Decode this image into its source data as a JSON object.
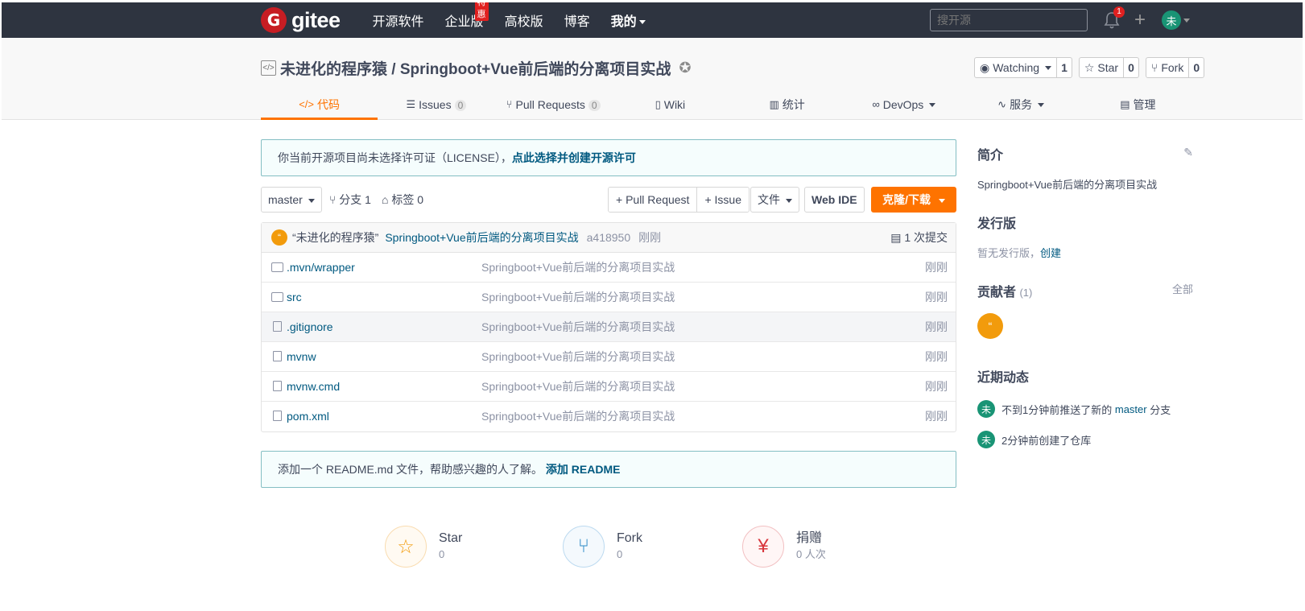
{
  "navbar": {
    "logo_mark": "G",
    "logo_text": "gitee",
    "items": [
      "开源软件",
      "企业版",
      "高校版",
      "博客",
      "我的"
    ],
    "hot_badge": "特惠",
    "search_placeholder": "搜开源",
    "notification_count": "1",
    "plus": "+",
    "user_initial": "未"
  },
  "project": {
    "title": "未进化的程序猿 / Springboot+Vue前后端的分离项目实战",
    "watching_label": "Watching",
    "watching_count": "1",
    "star_label": "Star",
    "star_count": "0",
    "fork_label": "Fork",
    "fork_count": "0"
  },
  "tabs": [
    {
      "label": "代码",
      "icon": "</>"
    },
    {
      "label": "Issues",
      "count": "0",
      "icon": "☰"
    },
    {
      "label": "Pull Requests",
      "count": "0",
      "icon": "⑂"
    },
    {
      "label": "Wiki",
      "icon": "▯"
    },
    {
      "label": "统计",
      "icon": "▥"
    },
    {
      "label": "DevOps",
      "icon": "∞"
    },
    {
      "label": "服务",
      "icon": "∿"
    },
    {
      "label": "管理",
      "icon": "▤"
    }
  ],
  "license_notice": {
    "text": "你当前开源项目尚未选择许可证（LICENSE），",
    "link": "点此选择并创建开源许可"
  },
  "toolbar": {
    "branch": "master",
    "branch_count_label": "分支 1",
    "tag_count_label": "标签 0",
    "pull_request": "+ Pull Request",
    "issue": "+ Issue",
    "file": "文件",
    "web_ide": "Web IDE",
    "clone": "克隆/下载"
  },
  "last_commit": {
    "avatar": "“",
    "author": "“未进化的程序猿”",
    "message": "Springboot+Vue前后端的分离项目实战",
    "sha": "a418950",
    "time": "刚刚",
    "count_label": "1 次提交"
  },
  "files": [
    {
      "name": ".mvn/wrapper",
      "type": "folder",
      "message": "Springboot+Vue前后端的分离项目实战",
      "time": "刚刚"
    },
    {
      "name": "src",
      "type": "folder",
      "message": "Springboot+Vue前后端的分离项目实战",
      "time": "刚刚"
    },
    {
      "name": ".gitignore",
      "type": "file",
      "message": "Springboot+Vue前后端的分离项目实战",
      "time": "刚刚"
    },
    {
      "name": "mvnw",
      "type": "file",
      "message": "Springboot+Vue前后端的分离项目实战",
      "time": "刚刚"
    },
    {
      "name": "mvnw.cmd",
      "type": "file",
      "message": "Springboot+Vue前后端的分离项目实战",
      "time": "刚刚"
    },
    {
      "name": "pom.xml",
      "type": "file",
      "message": "Springboot+Vue前后端的分离项目实战",
      "time": "刚刚"
    }
  ],
  "readme_notice": {
    "text": "添加一个 README.md 文件，帮助感兴趣的人了解。",
    "link": "添加 README"
  },
  "stats": [
    {
      "title": "Star",
      "value": "0",
      "icon": "☆",
      "color": "#f29b0c"
    },
    {
      "title": "Fork",
      "value": "0",
      "icon": "⑂",
      "color": "#2d8ac7"
    },
    {
      "title": "捐赠",
      "value": "0 人次",
      "icon": "¥",
      "color": "#d8363d"
    }
  ],
  "sidebar": {
    "intro_title": "简介",
    "intro_text": "Springboot+Vue前后端的分离项目实战",
    "release_title": "发行版",
    "release_text": "暂无发行版，",
    "release_link": "创建",
    "contrib_title": "贡献者",
    "contrib_count": "(1)",
    "contrib_all": "全部",
    "contrib_avatar": "“",
    "activity_title": "近期动态",
    "activity": [
      {
        "avatar": "未",
        "pre": "不到1分钟前推送了新的",
        "link": "master",
        "post": "分支"
      },
      {
        "avatar": "未",
        "pre": "2分钟前创建了仓库",
        "link": "",
        "post": ""
      }
    ]
  }
}
